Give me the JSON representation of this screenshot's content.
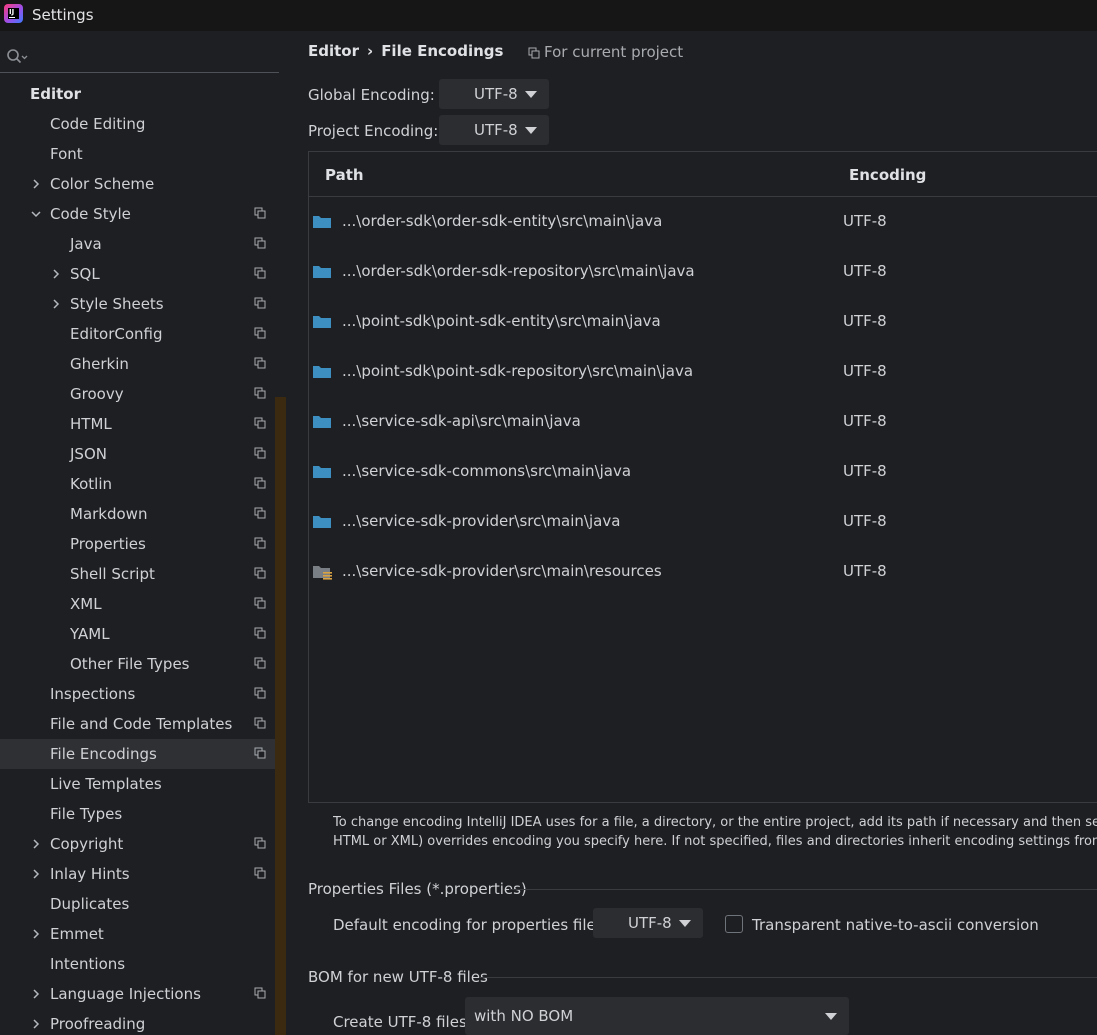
{
  "window": {
    "title": "Settings",
    "logo_text": "IJ"
  },
  "sidebar": {
    "search_placeholder": "",
    "items": [
      {
        "label": "Editor",
        "level": 0,
        "header": true
      },
      {
        "label": "Code Editing",
        "level": 1
      },
      {
        "label": "Font",
        "level": 1
      },
      {
        "label": "Color Scheme",
        "level": 1,
        "chevron": "right"
      },
      {
        "label": "Code Style",
        "level": 1,
        "chevron": "down",
        "copy": true
      },
      {
        "label": "Java",
        "level": 2,
        "copy": true
      },
      {
        "label": "SQL",
        "level": 2,
        "chevron": "right",
        "copy": true
      },
      {
        "label": "Style Sheets",
        "level": 2,
        "chevron": "right",
        "copy": true
      },
      {
        "label": "EditorConfig",
        "level": 2,
        "copy": true
      },
      {
        "label": "Gherkin",
        "level": 2,
        "copy": true
      },
      {
        "label": "Groovy",
        "level": 2,
        "copy": true
      },
      {
        "label": "HTML",
        "level": 2,
        "copy": true
      },
      {
        "label": "JSON",
        "level": 2,
        "copy": true
      },
      {
        "label": "Kotlin",
        "level": 2,
        "copy": true
      },
      {
        "label": "Markdown",
        "level": 2,
        "copy": true
      },
      {
        "label": "Properties",
        "level": 2,
        "copy": true
      },
      {
        "label": "Shell Script",
        "level": 2,
        "copy": true
      },
      {
        "label": "XML",
        "level": 2,
        "copy": true
      },
      {
        "label": "YAML",
        "level": 2,
        "copy": true
      },
      {
        "label": "Other File Types",
        "level": 2,
        "copy": true
      },
      {
        "label": "Inspections",
        "level": 1,
        "copy": true
      },
      {
        "label": "File and Code Templates",
        "level": 1,
        "copy": true
      },
      {
        "label": "File Encodings",
        "level": 1,
        "copy": true,
        "selected": true
      },
      {
        "label": "Live Templates",
        "level": 1
      },
      {
        "label": "File Types",
        "level": 1
      },
      {
        "label": "Copyright",
        "level": 1,
        "chevron": "right",
        "copy": true
      },
      {
        "label": "Inlay Hints",
        "level": 1,
        "chevron": "right",
        "copy": true
      },
      {
        "label": "Duplicates",
        "level": 1
      },
      {
        "label": "Emmet",
        "level": 1,
        "chevron": "right"
      },
      {
        "label": "Intentions",
        "level": 1
      },
      {
        "label": "Language Injections",
        "level": 1,
        "chevron": "right",
        "copy": true
      },
      {
        "label": "Proofreading",
        "level": 1,
        "chevron": "right"
      }
    ]
  },
  "breadcrumb": {
    "parent": "Editor",
    "separator": "›",
    "current": "File Encodings",
    "scope": "For current project"
  },
  "global_encoding": {
    "label": "Global Encoding:",
    "value": "UTF-8"
  },
  "project_encoding": {
    "label": "Project Encoding:",
    "value": "UTF-8"
  },
  "table": {
    "columns": [
      "Path",
      "Encoding"
    ],
    "rows": [
      {
        "path": "...\\order-sdk\\order-sdk-entity\\src\\main\\java",
        "encoding": "UTF-8",
        "icon": "folder-icon"
      },
      {
        "path": "...\\order-sdk\\order-sdk-repository\\src\\main\\java",
        "encoding": "UTF-8",
        "icon": "folder-icon"
      },
      {
        "path": "...\\point-sdk\\point-sdk-entity\\src\\main\\java",
        "encoding": "UTF-8",
        "icon": "folder-icon"
      },
      {
        "path": "...\\point-sdk\\point-sdk-repository\\src\\main\\java",
        "encoding": "UTF-8",
        "icon": "folder-icon"
      },
      {
        "path": "...\\service-sdk-api\\src\\main\\java",
        "encoding": "UTF-8",
        "icon": "folder-icon"
      },
      {
        "path": "...\\service-sdk-commons\\src\\main\\java",
        "encoding": "UTF-8",
        "icon": "folder-icon"
      },
      {
        "path": "...\\service-sdk-provider\\src\\main\\java",
        "encoding": "UTF-8",
        "icon": "folder-icon"
      },
      {
        "path": "...\\service-sdk-provider\\src\\main\\resources",
        "encoding": "UTF-8",
        "icon": "resources-folder-icon"
      }
    ]
  },
  "note": {
    "line1": "To change encoding IntelliJ IDEA uses for a file, a directory, or the entire project, add its path if necessary and then select encoding",
    "line2": "HTML or XML) overrides encoding you specify here. If not specified, files and directories inherit encoding settings from the parent"
  },
  "properties_section": {
    "title": "Properties Files (*.properties)",
    "default_label": "Default encoding for properties files:",
    "default_value": "UTF-8",
    "transparent_label": "Transparent native-to-ascii conversion",
    "transparent_checked": false
  },
  "bom_section": {
    "title": "BOM for new UTF-8 files",
    "create_label": "Create UTF-8 files:",
    "create_value": "with NO BOM"
  },
  "colors": {
    "background": "#1e1f22",
    "selected_row": "#2e3033",
    "folder_blue": "#3d8fc2",
    "scrollbar": "#3c2a10",
    "resources_marker": "#d9a343"
  }
}
